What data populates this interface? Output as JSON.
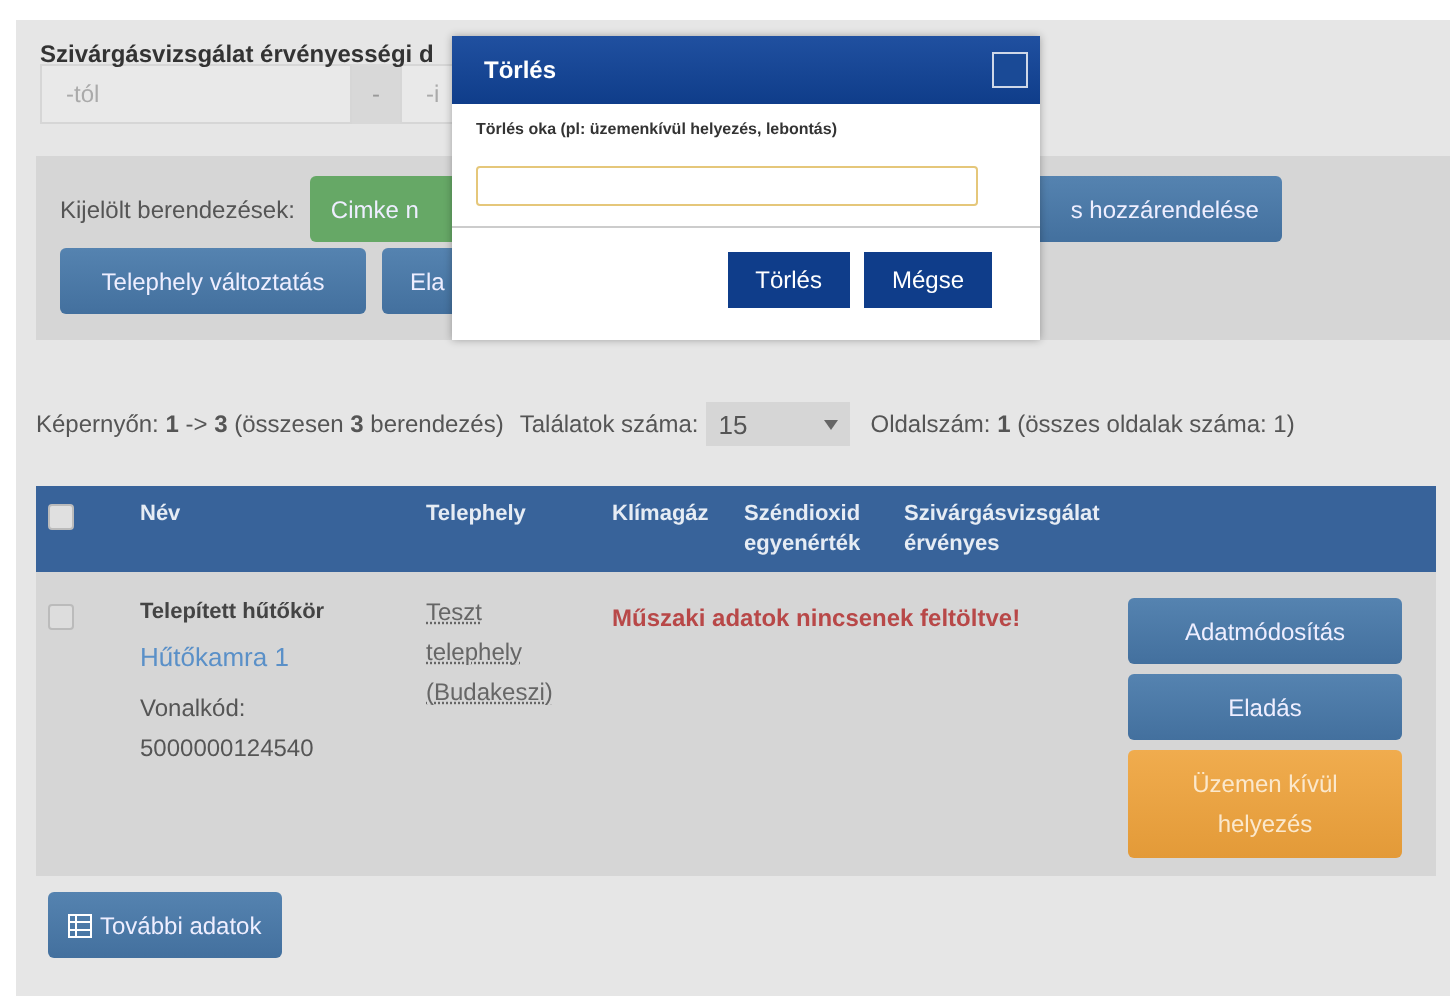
{
  "filter": {
    "title": "Szivárgásvizsgálat érvényességi d",
    "from_placeholder": "-tól",
    "separator": "-",
    "to_placeholder": "-i"
  },
  "toolbar": {
    "label": "Kijelölt berendezések:",
    "buttons": [
      {
        "label": "Cimke n",
        "kind": "success"
      },
      {
        "label": "s hozzárendelése",
        "kind": "primary"
      },
      {
        "label": "Telephely változtatás",
        "kind": "primary"
      },
      {
        "label": "Ela",
        "kind": "primary"
      }
    ]
  },
  "info": {
    "range": "Képernyőn: **1** -> **3** (összesen **3** berendezés)",
    "per_page_label": "Találatok száma:",
    "per_page": "15",
    "pages": "Oldalszám: **1** (összes oldalak száma: 1)"
  },
  "table": {
    "select_all": {
      "checked": false
    },
    "columns": [
      "Név",
      "Telephely",
      "Klímagáz",
      "Széndioxid egyenérték",
      "Szivárgásvizsgálat érvényes"
    ],
    "rows": [
      {
        "checked": false,
        "type": "Telepített hűtőkör",
        "name": "Hűtőkamra 1",
        "barcode_label": "Vonalkód:",
        "barcode": "5000000124540",
        "site": "Teszt telephely (Budakeszi)",
        "warning": "Műszaki adatok nincsenek feltöltve!",
        "actions": [
          {
            "label": "Adatmódosítás",
            "kind": "primary"
          },
          {
            "label": "Eladás",
            "kind": "primary"
          },
          {
            "label": "Üzemen kívül helyezés",
            "kind": "warning"
          }
        ]
      }
    ]
  },
  "more_button": "További adatok",
  "dialog": {
    "title": "Törlés",
    "field_label": "Törlés oka (pl: üzemenkívül helyezés, lebontás)",
    "buttons": [
      "Törlés",
      "Mégse"
    ]
  }
}
